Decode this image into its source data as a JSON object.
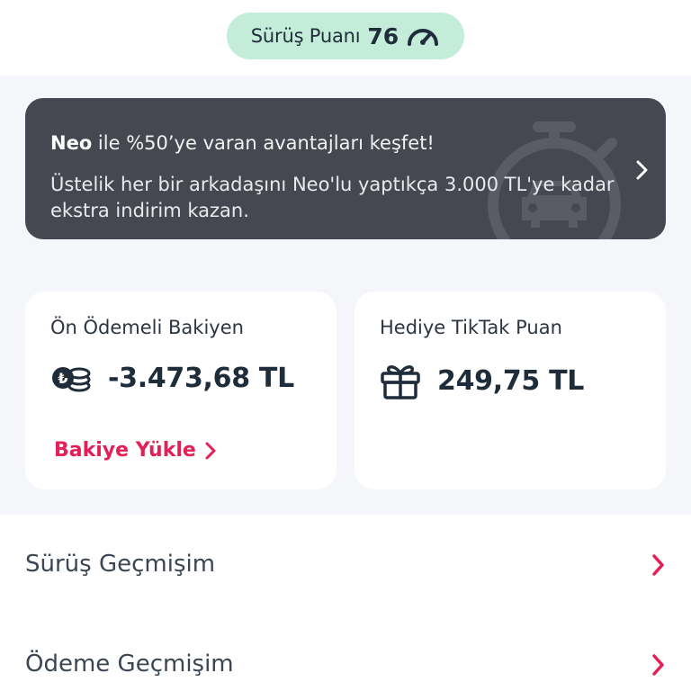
{
  "header": {
    "score_label": "Sürüş Puanı",
    "score_value": "76"
  },
  "promo": {
    "brand": "Neo",
    "title_rest": " ile %50’ye varan avantajları keşfet!",
    "description": "Üstelik her bir arkadaşını Neo'lu yaptıkça 3.000 TL'ye kadar ekstra indirim kazan."
  },
  "balance_card": {
    "title": "Ön Ödemeli Bakiyen",
    "amount": "-3.473,68 TL",
    "topup_label": "Bakiye Yükle"
  },
  "points_card": {
    "title": "Hediye TikTak Puan",
    "amount": "249,75 TL"
  },
  "menu": {
    "items": [
      {
        "label": "Sürüş Geçmişim"
      },
      {
        "label": "Ödeme Geçmişim"
      }
    ]
  },
  "colors": {
    "accent": "#e32058",
    "pill_bg": "#c3ecd9",
    "banner_bg": "#454851",
    "section_bg": "#f4f6f9",
    "text_dark": "#1f2d3a"
  }
}
